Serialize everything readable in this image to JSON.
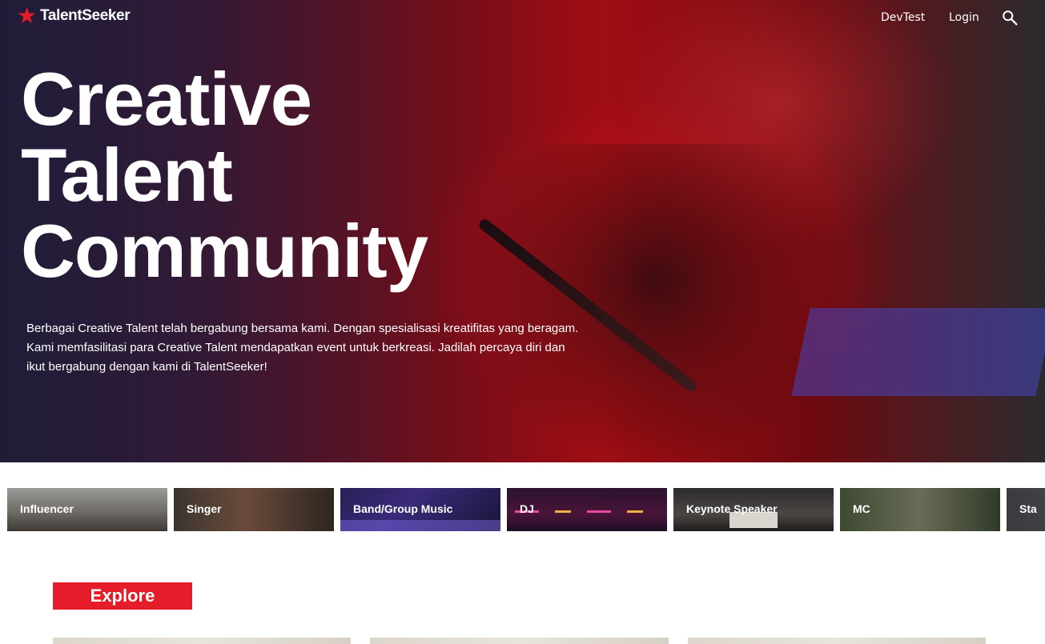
{
  "header": {
    "logo_text": "TalentSeeker",
    "nav_links": [
      "DevTest",
      "Login"
    ]
  },
  "hero": {
    "title_lines": [
      "Creative",
      "Talent",
      "Community"
    ],
    "description": "Berbagai Creative Talent telah bergabung bersama kami. Dengan spesialisasi kreatifitas yang beragam. Kami memfasilitasi para Creative Talent mendapatkan event untuk berkreasi. Jadilah percaya diri dan ikut bergabung dengan kami di TalentSeeker!"
  },
  "categories": [
    "Influencer",
    "Singer",
    "Band/Group Music",
    "DJ",
    "Keynote Speaker",
    "MC",
    "Sta"
  ],
  "explore": {
    "title": "Explore"
  },
  "colors": {
    "brand_red": "#e51d2a",
    "text_on_dark": "#ffffff"
  },
  "icons": {
    "logo": "star-icon",
    "search": "search-icon"
  }
}
